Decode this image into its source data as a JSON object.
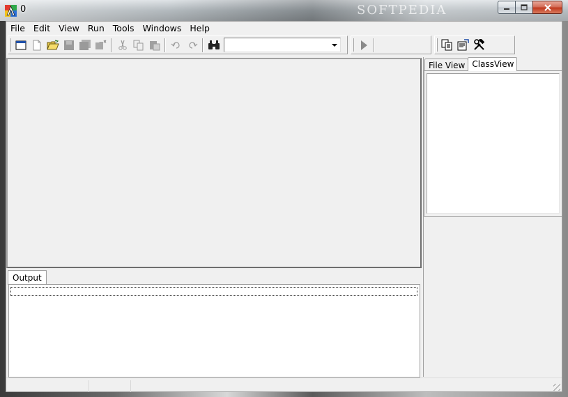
{
  "window": {
    "title": "0",
    "watermark": "SOFTPEDIA",
    "controls": {
      "minimize": "minimize",
      "maximize": "maximize",
      "close": "close"
    }
  },
  "menu": {
    "items": [
      {
        "label": "File"
      },
      {
        "label": "Edit"
      },
      {
        "label": "View"
      },
      {
        "label": "Run"
      },
      {
        "label": "Tools"
      },
      {
        "label": "Windows"
      },
      {
        "label": "Help"
      }
    ]
  },
  "toolbar": {
    "buttons": [
      {
        "name": "new-window-icon"
      },
      {
        "name": "new-file-icon"
      },
      {
        "name": "open-folder-icon"
      },
      {
        "name": "save-icon"
      },
      {
        "name": "save-all-icon"
      },
      {
        "name": "close-folder-icon"
      },
      {
        "name": "cut-icon"
      },
      {
        "name": "copy-icon"
      },
      {
        "name": "paste-icon"
      },
      {
        "name": "undo-icon"
      },
      {
        "name": "redo-icon"
      },
      {
        "name": "find-binoculars-icon"
      }
    ],
    "search_value": "",
    "run_icon": "play-icon",
    "tools_icons": [
      "copy-docs-icon",
      "properties-icon",
      "build-tools-icon"
    ]
  },
  "right_panel": {
    "tabs": [
      {
        "label": "File View",
        "active": false
      },
      {
        "label": "ClassView",
        "active": true
      }
    ]
  },
  "output": {
    "tab_label": "Output"
  },
  "colors": {
    "window_bg": "#f0f0f0",
    "border": "#a0a0a0"
  }
}
